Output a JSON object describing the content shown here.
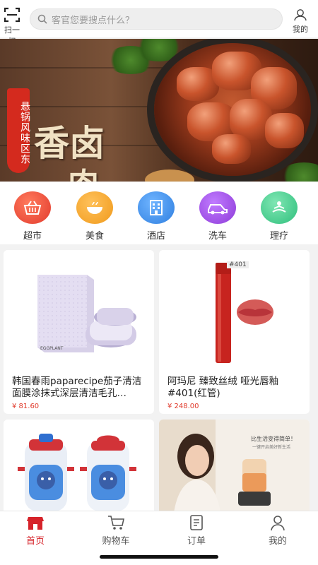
{
  "header": {
    "scan_label": "扫一扫",
    "search_placeholder": "客官您要搜点什么？",
    "mine_label": "我的"
  },
  "banner": {
    "tag_text": "悬锅风味区东",
    "title_char1": "香卤",
    "title_char2": "肉"
  },
  "categories": [
    {
      "label": "超市",
      "icon": "basket-icon",
      "color": "#e84a3a"
    },
    {
      "label": "美食",
      "icon": "bowl-icon",
      "color": "#f3a024"
    },
    {
      "label": "酒店",
      "icon": "building-icon",
      "color": "#3a8de8"
    },
    {
      "label": "洗车",
      "icon": "car-icon",
      "color": "#9b46e0"
    },
    {
      "label": "理疗",
      "icon": "spa-icon",
      "color": "#3fc98a"
    }
  ],
  "products": [
    {
      "title": "韩国春雨paparecipe茄子清洁面膜涂抹式深层清洁毛孔…",
      "price": "¥ 81.60",
      "brand_text": "EGGPLANT",
      "variant_text": ""
    },
    {
      "title": "阿玛尼 臻致丝绒 哑光唇釉#401(红管)",
      "price": "¥ 248.00",
      "brand_text": "",
      "variant_text": "#401"
    },
    {
      "title": "",
      "price": "",
      "brand_text": "",
      "variant_text": ""
    },
    {
      "title": "",
      "price": "",
      "brand_text": "",
      "variant_text": "",
      "poster_line1": "比生活变得简单！",
      "poster_line2": "一键开启美好新生活"
    }
  ],
  "tabbar": {
    "items": [
      {
        "label": "首页",
        "icon": "home-store-icon",
        "active": true
      },
      {
        "label": "购物车",
        "icon": "cart-icon",
        "active": false
      },
      {
        "label": "订单",
        "icon": "order-icon",
        "active": false
      },
      {
        "label": "我的",
        "icon": "user-icon",
        "active": false
      }
    ]
  }
}
